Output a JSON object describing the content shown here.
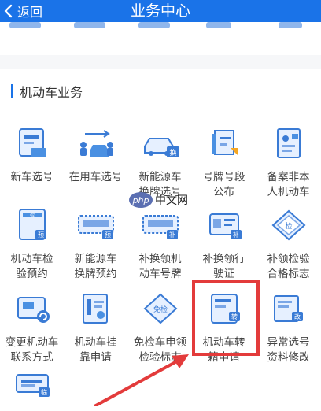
{
  "header": {
    "title": "业务中心",
    "back_label": "返回",
    "color": "#1a73e8"
  },
  "section": {
    "title": "机动车业务"
  },
  "items": [
    {
      "name": "car-select-number",
      "line1": "新车选号",
      "line2": ""
    },
    {
      "name": "used-car-select-number",
      "line1": "在用车选号",
      "line2": ""
    },
    {
      "name": "new-energy-plate-select",
      "line1": "新能源车",
      "line2": "换牌选号"
    },
    {
      "name": "plate-segment-announcement",
      "line1": "号牌号段",
      "line2": "公布"
    },
    {
      "name": "record-nonlocal-vehicle",
      "line1": "备案非本",
      "line2": "人机动车"
    },
    {
      "name": "inspection-appointment",
      "line1": "机动车检",
      "line2": "验预约"
    },
    {
      "name": "new-energy-plate-appointment",
      "line1": "新能源车",
      "line2": "换牌预约"
    },
    {
      "name": "replace-plate",
      "line1": "补换领机",
      "line2": "动车号牌"
    },
    {
      "name": "replace-license",
      "line1": "补换领行",
      "line2": "驶证"
    },
    {
      "name": "replace-inspection-mark",
      "line1": "补领检验",
      "line2": "合格标志"
    },
    {
      "name": "change-contact",
      "line1": "变更机动车",
      "line2": "联系方式"
    },
    {
      "name": "vehicle-affiliation",
      "line1": "机动车挂",
      "line2": "靠申请"
    },
    {
      "name": "inspection-free-mark",
      "line1": "免检车申领",
      "line2": "检验标志"
    },
    {
      "name": "vehicle-transfer",
      "line1": "机动车转",
      "line2": "籍申请"
    },
    {
      "name": "abnormal-number-change",
      "line1": "异常选号",
      "line2": "资料修改"
    },
    {
      "name": "temporary-plate",
      "line1": "",
      "line2": ""
    }
  ],
  "badges": {
    "swap": "换",
    "fill": "补",
    "check": "检",
    "pre": "预",
    "free_check": "免检",
    "transfer": "转",
    "change": "改",
    "temp": "临"
  },
  "watermark": {
    "logo": "php",
    "text": "中文网"
  }
}
